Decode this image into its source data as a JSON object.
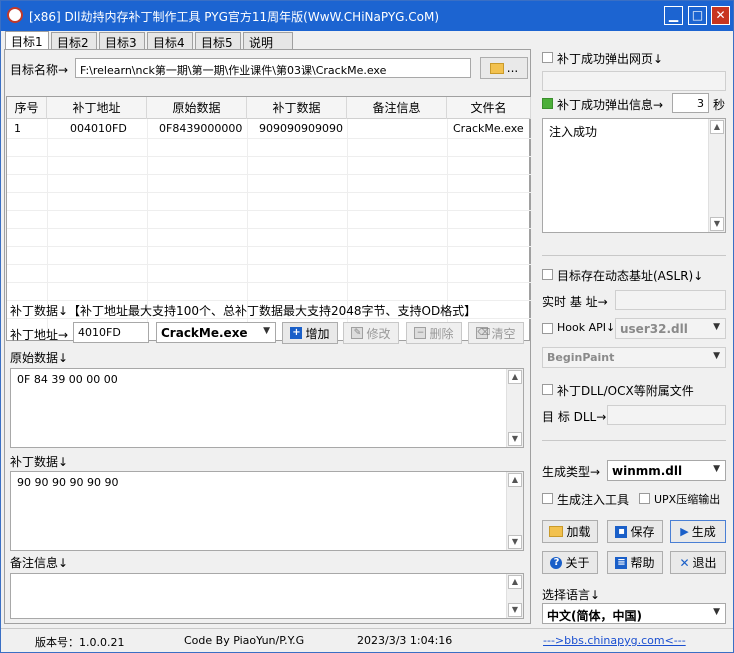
{
  "window": {
    "title": "[x86] Dll劫持内存补丁制作工具  PYG官方11周年版(WwW.CHiNaPYG.CoM)",
    "minimize_glyph": "▁",
    "maximize_glyph": "□",
    "close_glyph": "✕"
  },
  "tabs": [
    {
      "label": "目标1",
      "active": true
    },
    {
      "label": "目标2"
    },
    {
      "label": "目标3"
    },
    {
      "label": "目标4"
    },
    {
      "label": "目标5"
    },
    {
      "label": "说明"
    }
  ],
  "target": {
    "label": "目标名称→",
    "path": "F:\\relearn\\nck第一期\\第一期\\作业课件\\第03课\\CrackMe.exe",
    "browse_label": "..."
  },
  "table": {
    "columns": [
      "序号",
      "补丁地址",
      "原始数据",
      "补丁数据",
      "备注信息",
      "文件名"
    ],
    "rows": [
      [
        "1",
        "004010FD",
        "0F8439000000",
        "909090909090",
        "",
        "CrackMe.exe"
      ]
    ]
  },
  "patch": {
    "info": "补丁数据↓【补丁地址最大支持100个、总补丁数据最大支持2048字节、支持OD格式】",
    "address_label": "补丁地址→",
    "address_value": "4010FD",
    "module_value": "CrackMe.exe",
    "add_label": "增加",
    "modify_label": "修改",
    "delete_label": "删除",
    "clear_label": "清空",
    "original_label": "原始数据↓",
    "original_value": "0F 84 39 00 00 00",
    "patch_label": "补丁数据↓",
    "patch_value": "90 90 90 90 90 90",
    "remark_label": "备注信息↓",
    "remark_value": ""
  },
  "right": {
    "popup_web_label": "补丁成功弹出网页↓",
    "popup_msg_label": "补丁成功弹出信息→",
    "popup_seconds": "3",
    "seconds_unit": "秒",
    "popup_msg_text": "注入成功",
    "aslr_label": "目标存在动态基址(ASLR)↓",
    "realtime_base_label": "实时 基 址→",
    "hook_api_label": "Hook API↓",
    "hook_dll": "user32.dll",
    "hook_func": "BeginPaint",
    "attach_label": "补丁DLL/OCX等附属文件",
    "target_dll_label": "目 标 DLL→",
    "gen_type_label": "生成类型→",
    "gen_type_value": "winmm.dll",
    "gen_injector_label": "生成注入工具",
    "upx_label": "UPX压缩输出",
    "load_label": "加载",
    "save_label": "保存",
    "generate_label": "生成",
    "about_label": "关于",
    "help_label": "帮助",
    "exit_label": "退出",
    "lang_label": "选择语言↓",
    "lang_value": "中文(简体，中国)"
  },
  "status": {
    "version": "版本号：1.0.0.21",
    "author": "Code By PiaoYun/P.Y.G",
    "datetime": "2023/3/3 1:04:16",
    "link": "--->bbs.chinapyg.com<---"
  },
  "colors": {
    "titlebar": "#1c64d1",
    "accent_green": "#4caf3a",
    "link": "#1a4fd0"
  }
}
